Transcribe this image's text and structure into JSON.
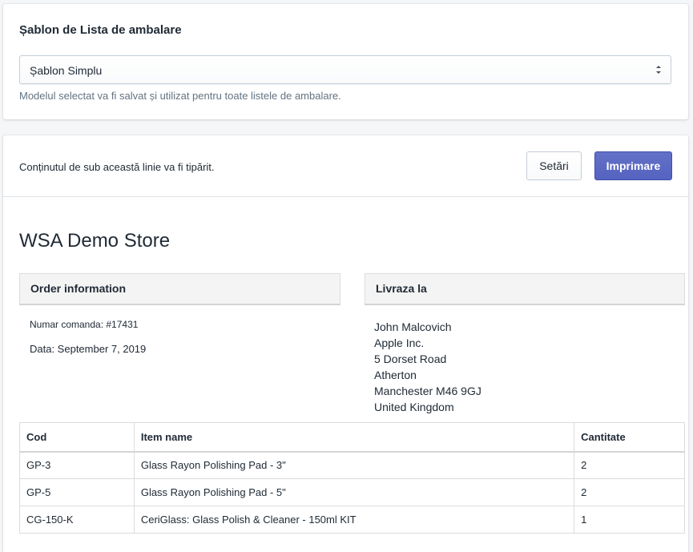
{
  "template_card": {
    "title": "Șablon de Lista de ambalare",
    "select_value": "Șablon Simplu",
    "help_text": "Modelul selectat va fi salvat și utilizat pentru toate listele de ambalare."
  },
  "print_card": {
    "info_text": "Conținutul de sub această linie va fi tipărit.",
    "settings_label": "Setări",
    "print_label": "Imprimare",
    "accent_color": "#5c6ac4"
  },
  "document": {
    "store_name": "WSA Demo Store",
    "order_info_heading": "Order information",
    "ship_to_heading": "Livraza la",
    "order_number": "Numar comanda: #17431",
    "order_date": "Data: September 7, 2019",
    "address": {
      "name": "John Malcovich",
      "company": "Apple Inc.",
      "street": "5 Dorset Road",
      "city": "Atherton",
      "region": "Manchester M46 9GJ",
      "country": "United Kingdom"
    },
    "table": {
      "headers": [
        "Cod",
        "Item name",
        "Cantitate"
      ],
      "rows": [
        [
          "GP-3",
          "Glass Rayon Polishing Pad - 3\"",
          "2"
        ],
        [
          "GP-5",
          "Glass Rayon Polishing Pad - 5\"",
          "2"
        ],
        [
          "CG-150-K",
          "CeriGlass: Glass Polish & Cleaner - 150ml KIT",
          "1"
        ]
      ]
    }
  }
}
